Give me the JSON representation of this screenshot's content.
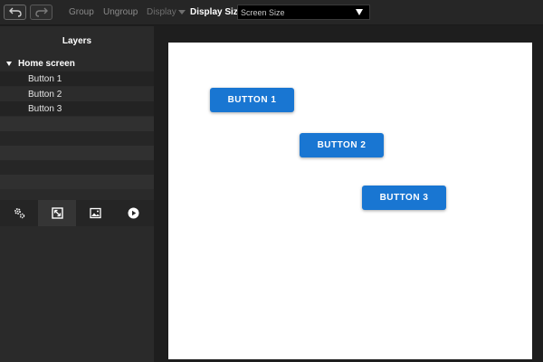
{
  "toolbar": {
    "undo_icon": "undo-icon",
    "redo_icon": "redo-icon",
    "group_label": "Group",
    "ungroup_label": "Ungroup",
    "display_label": "Display",
    "display_size_label": "Display Size :",
    "display_size_value": "Screen Size"
  },
  "layers": {
    "title": "Layers",
    "root": {
      "label": "Home screen",
      "expanded": true
    },
    "children": [
      {
        "label": "Button 1"
      },
      {
        "label": "Button 2"
      },
      {
        "label": "Button 3"
      }
    ]
  },
  "panel_tabs": [
    {
      "icon": "settings-icon",
      "active": false
    },
    {
      "icon": "resize-icon",
      "active": true
    },
    {
      "icon": "image-icon",
      "active": false
    },
    {
      "icon": "play-icon",
      "active": false
    }
  ],
  "canvas": {
    "buttons": [
      {
        "label": "BUTTON 1"
      },
      {
        "label": "BUTTON 2"
      },
      {
        "label": "BUTTON 3"
      }
    ]
  },
  "colors": {
    "button_blue": "#1976d2",
    "canvas_bg": "#ffffff",
    "app_bg": "#1e1e1e"
  }
}
